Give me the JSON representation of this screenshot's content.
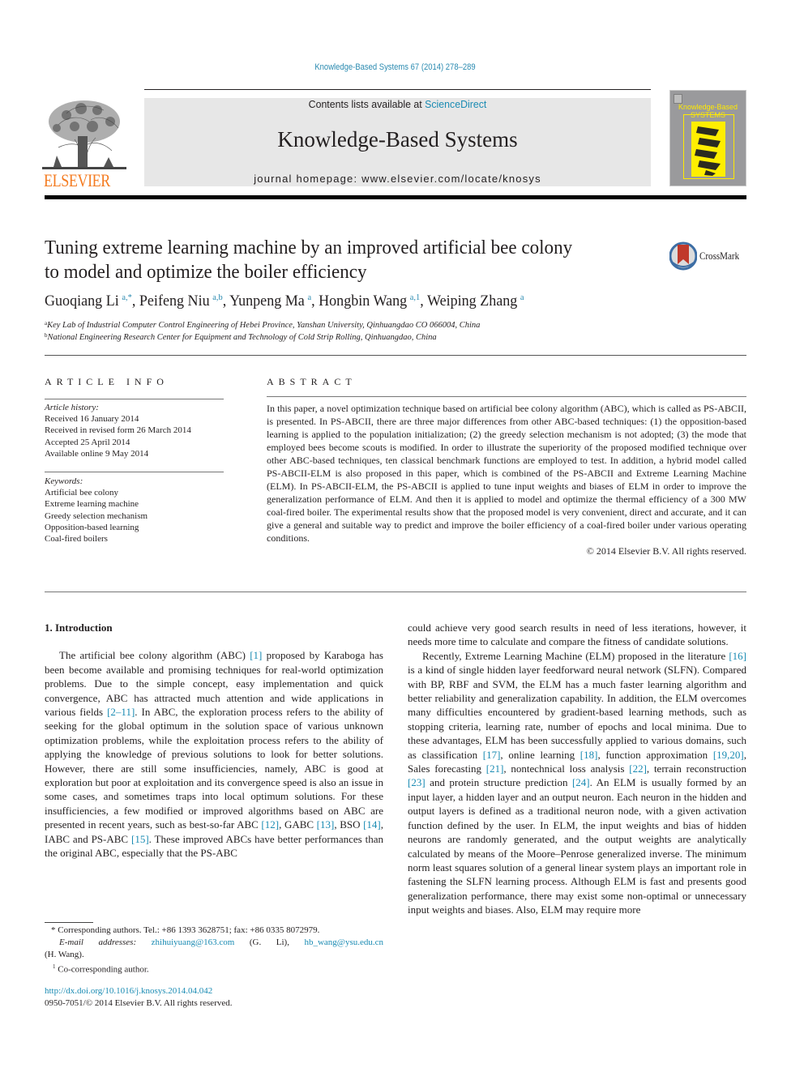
{
  "header": {
    "citation": "Knowledge-Based Systems 67 (2014) 278–289",
    "publisher_logo_text": "ELSEVIER",
    "contents_prefix": "Contents lists available at ",
    "contents_link": "ScienceDirect",
    "journal_name": "Knowledge-Based Systems",
    "homepage_label": "journal homepage: ",
    "homepage_url": "www.elsevier.com/locate/knosys",
    "cover_title_line1": "Knowledge-Based",
    "cover_title_line2": "SYSTEMS",
    "crossmark_label": "CrossMark"
  },
  "article": {
    "title_line1": "Tuning extreme learning machine by an improved artificial bee colony",
    "title_line2": "to model and optimize the boiler efficiency",
    "authors": [
      {
        "name": "Guoqiang Li",
        "sup": "a,*"
      },
      {
        "name": "Peifeng Niu",
        "sup": "a,b"
      },
      {
        "name": "Yunpeng Ma",
        "sup": "a"
      },
      {
        "name": "Hongbin Wang",
        "sup": "a,1"
      },
      {
        "name": "Weiping Zhang",
        "sup": "a"
      }
    ],
    "affiliations": [
      {
        "mark": "a",
        "text": "Key Lab of Industrial Computer Control Engineering of Hebei Province, Yanshan University, Qinhuangdao CO 066004, China"
      },
      {
        "mark": "b",
        "text": "National Engineering Research Center for Equipment and Technology of Cold Strip Rolling, Qinhuangdao, China"
      }
    ]
  },
  "article_info": {
    "heading": "ARTICLE INFO",
    "history_label": "Article history:",
    "history": [
      "Received 16 January 2014",
      "Received in revised form 26 March 2014",
      "Accepted 25 April 2014",
      "Available online 9 May 2014"
    ],
    "keywords_label": "Keywords:",
    "keywords": [
      "Artificial bee colony",
      "Extreme learning machine",
      "Greedy selection mechanism",
      "Opposition-based learning",
      "Coal-fired boilers"
    ]
  },
  "abstract": {
    "heading": "ABSTRACT",
    "text": "In this paper, a novel optimization technique based on artificial bee colony algorithm (ABC), which is called as PS-ABCII, is presented. In PS-ABCII, there are three major differences from other ABC-based techniques: (1) the opposition-based learning is applied to the population initialization; (2) the greedy selection mechanism is not adopted; (3) the mode that employed bees become scouts is modified. In order to illustrate the superiority of the proposed modified technique over other ABC-based techniques, ten classical benchmark functions are employed to test. In addition, a hybrid model called PS-ABCII-ELM is also proposed in this paper, which is combined of the PS-ABCII and Extreme Learning Machine (ELM). In PS-ABCII-ELM, the PS-ABCII is applied to tune input weights and biases of ELM in order to improve the generalization performance of ELM. And then it is applied to model and optimize the thermal efficiency of a 300 MW coal-fired boiler. The experimental results show that the proposed model is very convenient, direct and accurate, and it can give a general and suitable way to predict and improve the boiler efficiency of a coal-fired boiler under various operating conditions.",
    "copyright": "© 2014 Elsevier B.V. All rights reserved."
  },
  "introduction": {
    "heading": "1. Introduction",
    "left_para": [
      {
        "t": "The artificial bee colony algorithm (ABC) "
      },
      {
        "r": "[1]"
      },
      {
        "t": " proposed by Karaboga has been become available and promising techniques for real-world optimization problems. Due to the simple concept, easy implementation and quick convergence, ABC has attracted much attention and wide applications in various fields "
      },
      {
        "r": "[2–11]"
      },
      {
        "t": ". In ABC, the exploration process refers to the ability of seeking for the global optimum in the solution space of various unknown optimization problems, while the exploitation process refers to the ability of applying the knowledge of previous solutions to look for better solutions. However, there are still some insufficiencies, namely, ABC is good at exploration but poor at exploitation and its convergence speed is also an issue in some cases, and sometimes traps into local optimum solutions. For these insufficiencies, a few modified or improved algorithms based on ABC are presented in recent years, such as best-so-far ABC "
      },
      {
        "r": "[12]"
      },
      {
        "t": ", GABC "
      },
      {
        "r": "[13]"
      },
      {
        "t": ", BSO "
      },
      {
        "r": "[14]"
      },
      {
        "t": ", IABC and PS-ABC "
      },
      {
        "r": "[15]"
      },
      {
        "t": ". These improved ABCs have better performances than the original ABC, especially that the PS-ABC"
      }
    ],
    "right_para1": "could achieve very good search results in need of less iterations, however, it needs more time to calculate and compare the fitness of candidate solutions.",
    "right_para2": [
      {
        "t": "Recently, Extreme Learning Machine (ELM) proposed in the literature "
      },
      {
        "r": "[16]"
      },
      {
        "t": " is a kind of single hidden layer feedforward neural network (SLFN). Compared with BP, RBF and SVM, the ELM has a much faster learning algorithm and better reliability and generalization capability. In addition, the ELM overcomes many difficulties encountered by gradient-based learning methods, such as stopping criteria, learning rate, number of epochs and local minima. Due to these advantages, ELM has been successfully applied to various domains, such as classification "
      },
      {
        "r": "[17]"
      },
      {
        "t": ", online learning "
      },
      {
        "r": "[18]"
      },
      {
        "t": ", function approximation "
      },
      {
        "r": "[19,20]"
      },
      {
        "t": ", Sales forecasting "
      },
      {
        "r": "[21]"
      },
      {
        "t": ", nontechnical loss analysis "
      },
      {
        "r": "[22]"
      },
      {
        "t": ", terrain reconstruction "
      },
      {
        "r": "[23]"
      },
      {
        "t": " and protein structure prediction "
      },
      {
        "r": "[24]"
      },
      {
        "t": ". An ELM is usually formed by an input layer, a hidden layer and an output neuron. Each neuron in the hidden and output layers is defined as a traditional neuron node, with a given activation function defined by the user. In ELM, the input weights and bias of hidden neurons are randomly generated, and the output weights are analytically calculated by means of the Moore–Penrose generalized inverse. The minimum norm least squares solution of a general linear system plays an important role in fastening the SLFN learning process. Although ELM is fast and presents good generalization performance, there may exist some non-optimal or unnecessary input weights and biases. Also, ELM may require more"
      }
    ]
  },
  "footnotes": {
    "corresponding_mark": "*",
    "corresponding_text": "Corresponding authors. Tel.: +86 1393 3628751; fax: +86 0335 8072979.",
    "email_label": "E-mail addresses:",
    "email1": "zhihuiyuang@163.com",
    "email1_owner": "(G. Li),",
    "email2": "hb_wang@ysu.edu.cn",
    "email2_owner": "(H. Wang).",
    "co_mark": "1",
    "co_text": "Co-corresponding author.",
    "doi": "http://dx.doi.org/10.1016/j.knosys.2014.04.042",
    "issn": "0950-7051/© 2014 Elsevier B.V. All rights reserved."
  }
}
